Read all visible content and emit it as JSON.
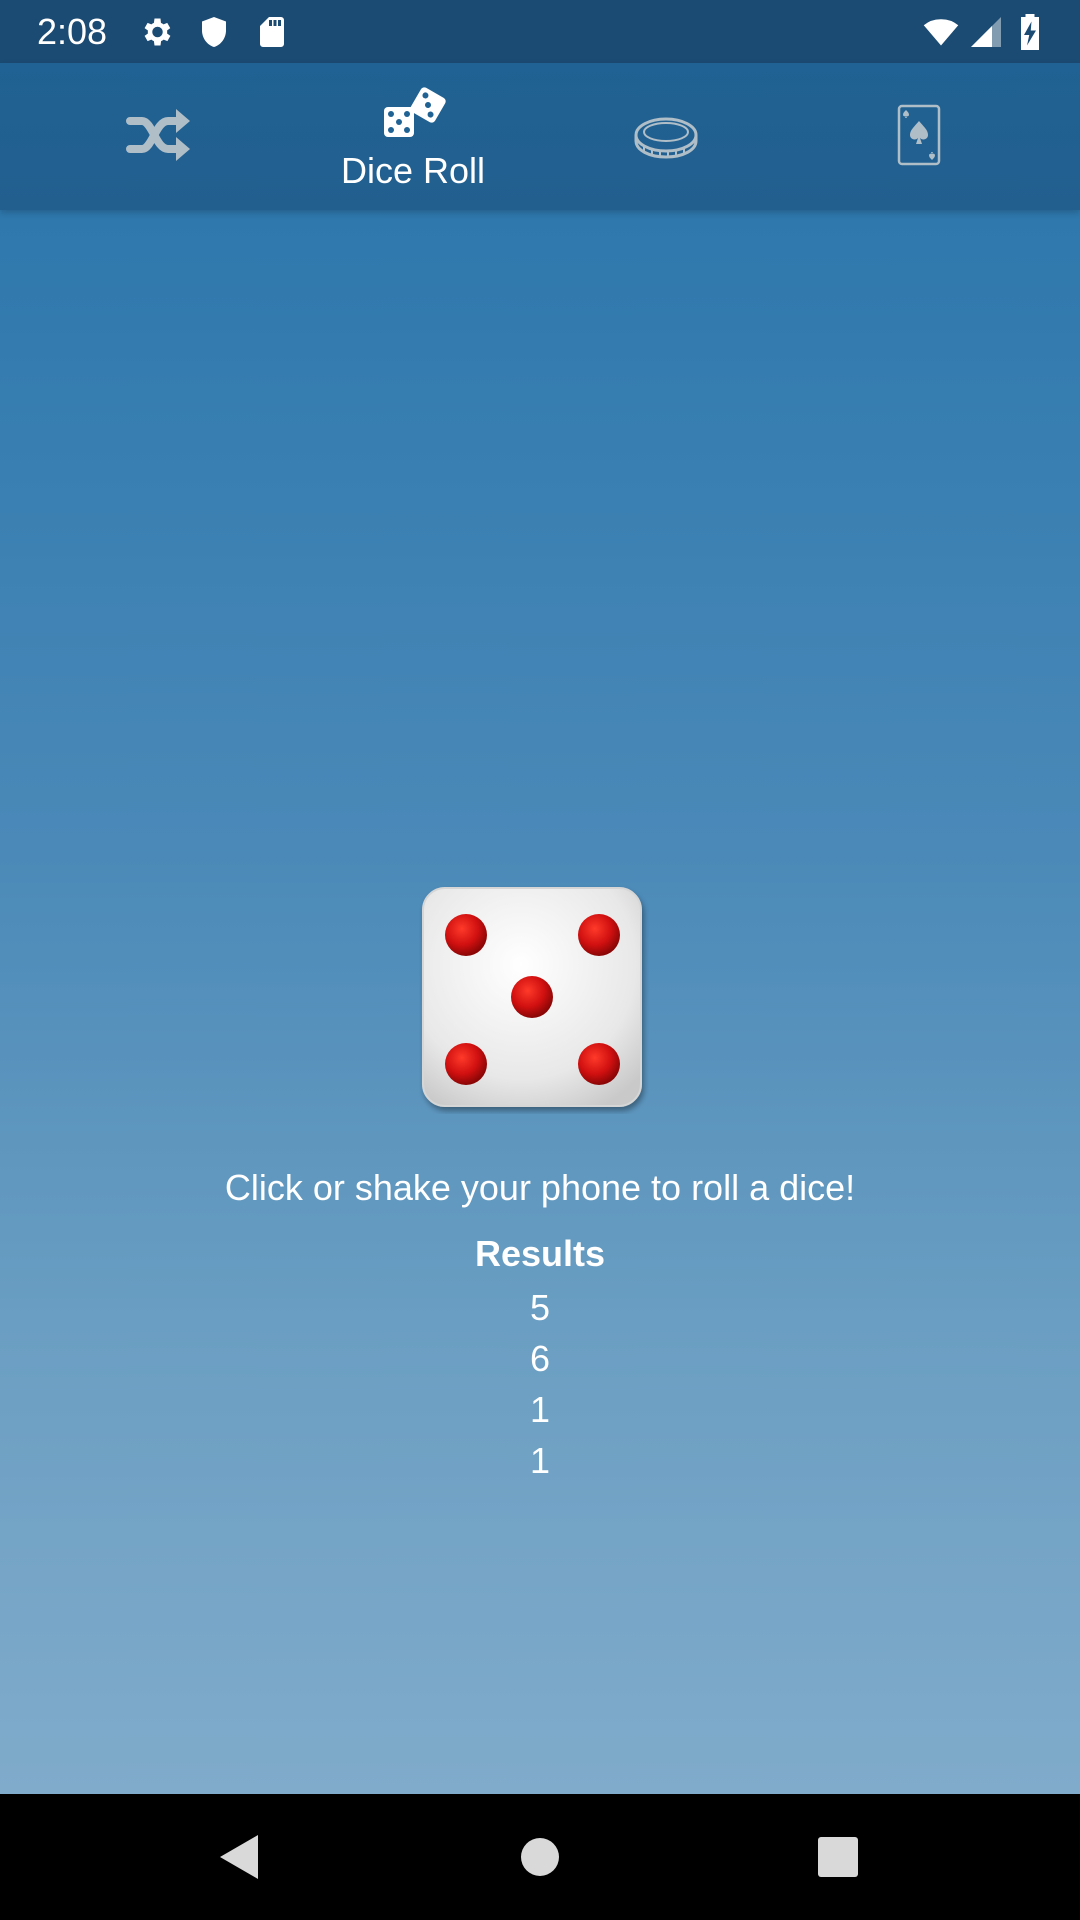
{
  "status_bar": {
    "time": "2:08",
    "left_icons": [
      "gear-icon",
      "shield-icon",
      "sd-card-icon"
    ],
    "right_icons": [
      "wifi-icon",
      "cell-signal-icon",
      "battery-charging-icon"
    ]
  },
  "tabs": [
    {
      "name": "shuffle",
      "icon": "shuffle-icon",
      "label": "",
      "active": false
    },
    {
      "name": "dice-roll",
      "icon": "dice-icon",
      "label": "Dice Roll",
      "active": true
    },
    {
      "name": "coin",
      "icon": "coin-icon",
      "label": "",
      "active": false
    },
    {
      "name": "card",
      "icon": "playing-card-icon",
      "label": "",
      "active": false
    }
  ],
  "main": {
    "dice_face_value": 5,
    "instruction": "Click or shake your phone to roll a dice!",
    "results_title": "Results",
    "results": [
      "5",
      "6",
      "1",
      "1"
    ]
  },
  "nav_bar": {
    "buttons": [
      "back-icon",
      "home-icon",
      "recents-icon"
    ]
  },
  "colors": {
    "status_bar": "#1b4a72",
    "tab_bar": "#1f6293",
    "background_top": "#2e78ad",
    "background_bottom": "#80abcb",
    "pip_red": "#d01010",
    "text": "#ffffff"
  }
}
